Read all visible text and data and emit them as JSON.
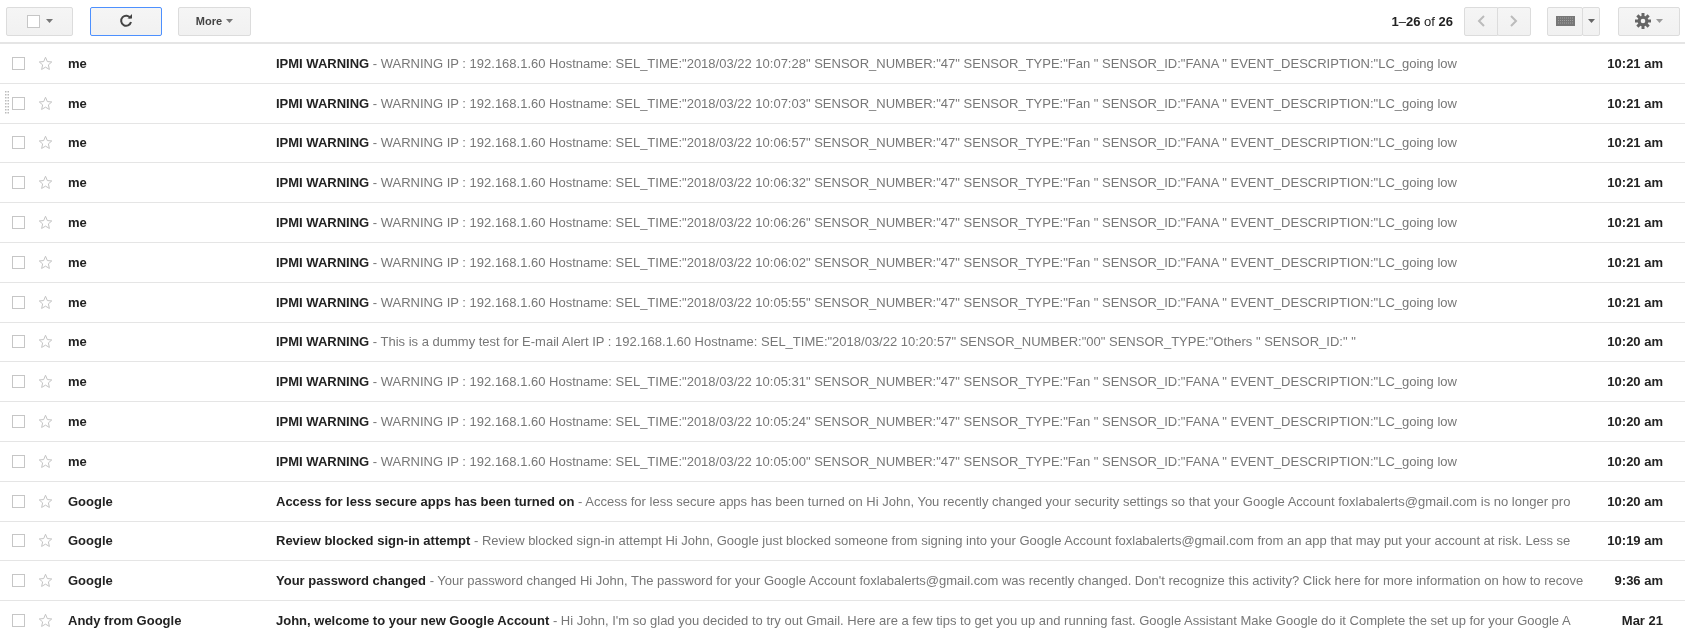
{
  "toolbar": {
    "select_button": {
      "checked": false
    },
    "refresh_button": {
      "focused": true
    },
    "more_button": {
      "label": "More"
    },
    "pagination": "**1**–**26** of **26**"
  },
  "messages": [
    {
      "sender": "me",
      "subject": "IPMI WARNING",
      "snippet": "- WARNING IP : 192.168.1.60 Hostname: SEL_TIME:\"2018/03/22 10:07:28\" SENSOR_NUMBER:\"47\" SENSOR_TYPE:\"Fan \" SENSOR_ID:\"FANA \" EVENT_DESCRIPTION:\"LC_going low",
      "time": "10:21 am",
      "checked": false,
      "starred": false,
      "drag_handle": false
    },
    {
      "sender": "me",
      "subject": "IPMI WARNING",
      "snippet": "- WARNING IP : 192.168.1.60 Hostname: SEL_TIME:\"2018/03/22 10:07:03\" SENSOR_NUMBER:\"47\" SENSOR_TYPE:\"Fan \" SENSOR_ID:\"FANA \" EVENT_DESCRIPTION:\"LC_going low",
      "time": "10:21 am",
      "checked": false,
      "starred": false,
      "drag_handle": true
    },
    {
      "sender": "me",
      "subject": "IPMI WARNING",
      "snippet": "- WARNING IP : 192.168.1.60 Hostname: SEL_TIME:\"2018/03/22 10:06:57\" SENSOR_NUMBER:\"47\" SENSOR_TYPE:\"Fan \" SENSOR_ID:\"FANA \" EVENT_DESCRIPTION:\"LC_going low",
      "time": "10:21 am",
      "checked": false,
      "starred": false,
      "drag_handle": false
    },
    {
      "sender": "me",
      "subject": "IPMI WARNING",
      "snippet": "- WARNING IP : 192.168.1.60 Hostname: SEL_TIME:\"2018/03/22 10:06:32\" SENSOR_NUMBER:\"47\" SENSOR_TYPE:\"Fan \" SENSOR_ID:\"FANA \" EVENT_DESCRIPTION:\"LC_going low",
      "time": "10:21 am",
      "checked": false,
      "starred": false,
      "drag_handle": false
    },
    {
      "sender": "me",
      "subject": "IPMI WARNING",
      "snippet": "- WARNING IP : 192.168.1.60 Hostname: SEL_TIME:\"2018/03/22 10:06:26\" SENSOR_NUMBER:\"47\" SENSOR_TYPE:\"Fan \" SENSOR_ID:\"FANA \" EVENT_DESCRIPTION:\"LC_going low",
      "time": "10:21 am",
      "checked": false,
      "starred": false,
      "drag_handle": false
    },
    {
      "sender": "me",
      "subject": "IPMI WARNING",
      "snippet": "- WARNING IP : 192.168.1.60 Hostname: SEL_TIME:\"2018/03/22 10:06:02\" SENSOR_NUMBER:\"47\" SENSOR_TYPE:\"Fan \" SENSOR_ID:\"FANA \" EVENT_DESCRIPTION:\"LC_going low",
      "time": "10:21 am",
      "checked": false,
      "starred": false,
      "drag_handle": false
    },
    {
      "sender": "me",
      "subject": "IPMI WARNING",
      "snippet": "- WARNING IP : 192.168.1.60 Hostname: SEL_TIME:\"2018/03/22 10:05:55\" SENSOR_NUMBER:\"47\" SENSOR_TYPE:\"Fan \" SENSOR_ID:\"FANA \" EVENT_DESCRIPTION:\"LC_going low",
      "time": "10:21 am",
      "checked": false,
      "starred": false,
      "drag_handle": false
    },
    {
      "sender": "me",
      "subject": "IPMI WARNING",
      "snippet": "- This is a dummy test for E-mail Alert IP : 192.168.1.60 Hostname: SEL_TIME:\"2018/03/22 10:20:57\" SENSOR_NUMBER:\"00\" SENSOR_TYPE:\"Others \" SENSOR_ID:\" \"",
      "time": "10:20 am",
      "checked": false,
      "starred": false,
      "drag_handle": false
    },
    {
      "sender": "me",
      "subject": "IPMI WARNING",
      "snippet": "- WARNING IP : 192.168.1.60 Hostname: SEL_TIME:\"2018/03/22 10:05:31\" SENSOR_NUMBER:\"47\" SENSOR_TYPE:\"Fan \" SENSOR_ID:\"FANA \" EVENT_DESCRIPTION:\"LC_going low",
      "time": "10:20 am",
      "checked": false,
      "starred": false,
      "drag_handle": false
    },
    {
      "sender": "me",
      "subject": "IPMI WARNING",
      "snippet": "- WARNING IP : 192.168.1.60 Hostname: SEL_TIME:\"2018/03/22 10:05:24\" SENSOR_NUMBER:\"47\" SENSOR_TYPE:\"Fan \" SENSOR_ID:\"FANA \" EVENT_DESCRIPTION:\"LC_going low",
      "time": "10:20 am",
      "checked": false,
      "starred": false,
      "drag_handle": false
    },
    {
      "sender": "me",
      "subject": "IPMI WARNING",
      "snippet": "- WARNING IP : 192.168.1.60 Hostname: SEL_TIME:\"2018/03/22 10:05:00\" SENSOR_NUMBER:\"47\" SENSOR_TYPE:\"Fan \" SENSOR_ID:\"FANA \" EVENT_DESCRIPTION:\"LC_going low",
      "time": "10:20 am",
      "checked": false,
      "starred": false,
      "drag_handle": false
    },
    {
      "sender": "Google",
      "subject": "Access for less secure apps has been turned on",
      "snippet": "- Access for less secure apps has been turned on Hi John, You recently changed your security settings so that your Google Account foxlabalerts@gmail.com is no longer pro",
      "time": "10:20 am",
      "checked": false,
      "starred": false,
      "drag_handle": false
    },
    {
      "sender": "Google",
      "subject": "Review blocked sign-in attempt",
      "snippet": "- Review blocked sign-in attempt Hi John, Google just blocked someone from signing into your Google Account foxlabalerts@gmail.com from an app that may put your account at risk. Less se",
      "time": "10:19 am",
      "checked": false,
      "starred": false,
      "drag_handle": false
    },
    {
      "sender": "Google",
      "subject": "Your password changed",
      "snippet": "- Your password changed Hi John, The password for your Google Account foxlabalerts@gmail.com was recently changed. Don't recognize this activity? Click here for more information on how to recove",
      "time": "9:36 am",
      "checked": false,
      "starred": false,
      "drag_handle": false
    },
    {
      "sender": "Andy from Google",
      "subject": "John, welcome to your new Google Account",
      "snippet": "- Hi John, I'm so glad you decided to try out Gmail. Here are a few tips to get you up and running fast. Google Assistant Make Google do it Complete the set up for your Google A",
      "time": "Mar 21",
      "checked": false,
      "starred": false,
      "drag_handle": false
    }
  ]
}
